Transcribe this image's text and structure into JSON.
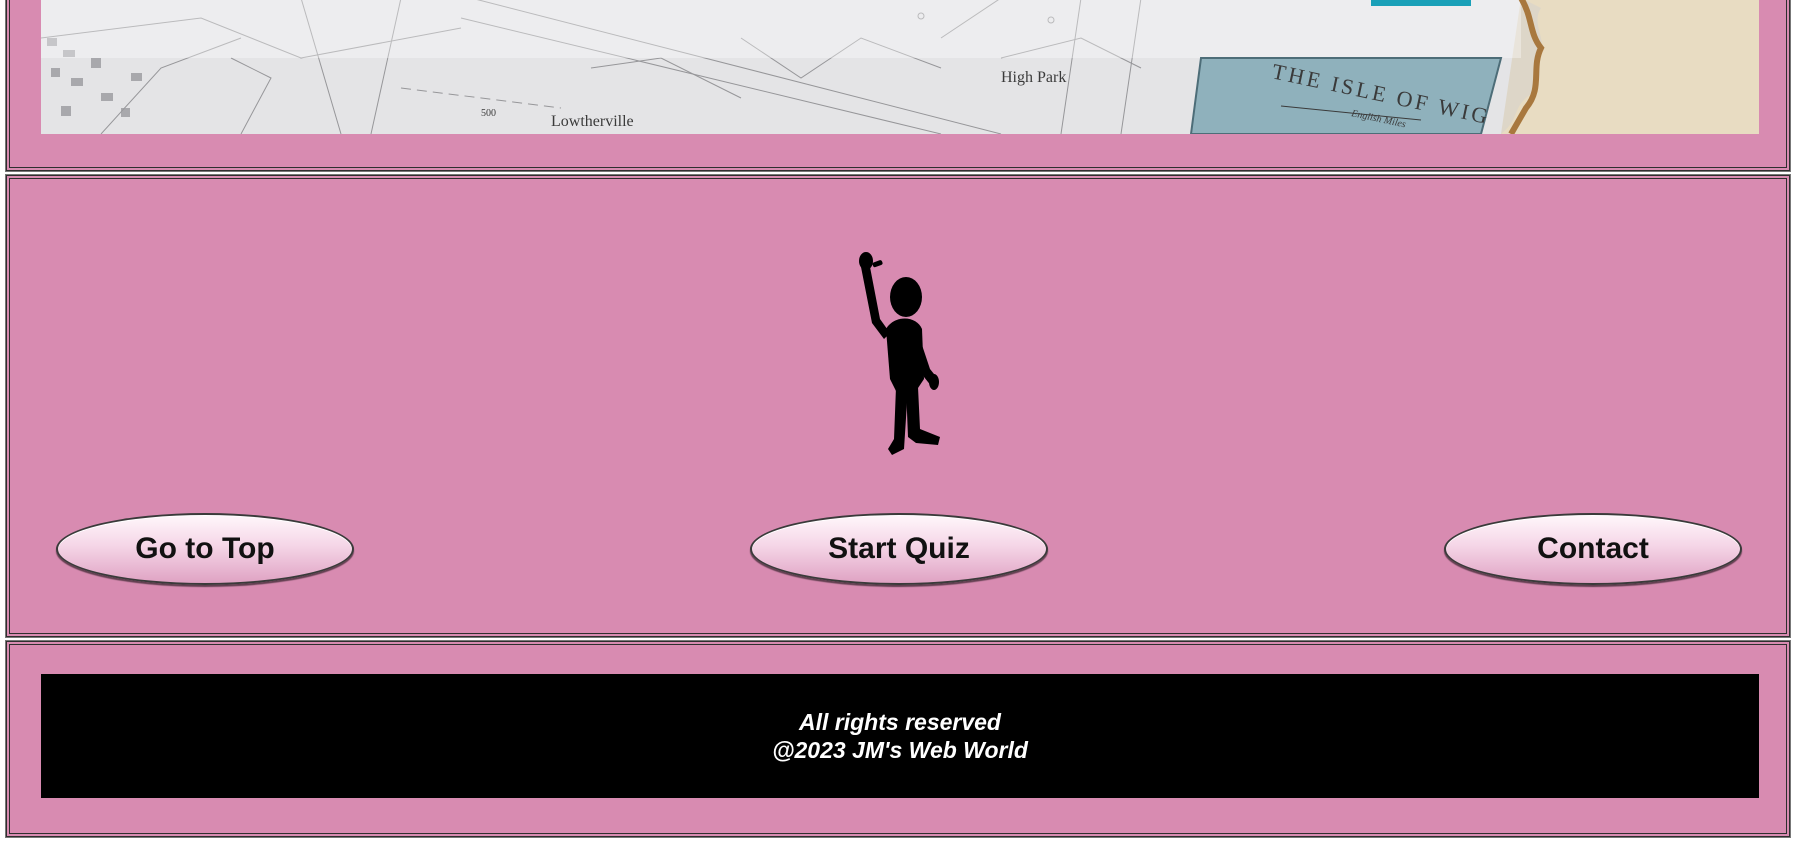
{
  "banner": {
    "map_labels": [
      "High Park",
      "Lowtherville",
      "THE ISLE OF WIG",
      "English Miles",
      "500"
    ]
  },
  "figure": {
    "icon": "waving-stick-figure"
  },
  "nav": {
    "go_to_top_label": "Go to Top",
    "start_quiz_label": "Start Quiz",
    "contact_label": "Contact"
  },
  "footer": {
    "line1": "All rights reserved",
    "line2": "@2023 JM's Web World"
  },
  "colors": {
    "page_bg": "#d88bb1",
    "footer_bg": "#000000",
    "footer_text": "#ffffff"
  }
}
